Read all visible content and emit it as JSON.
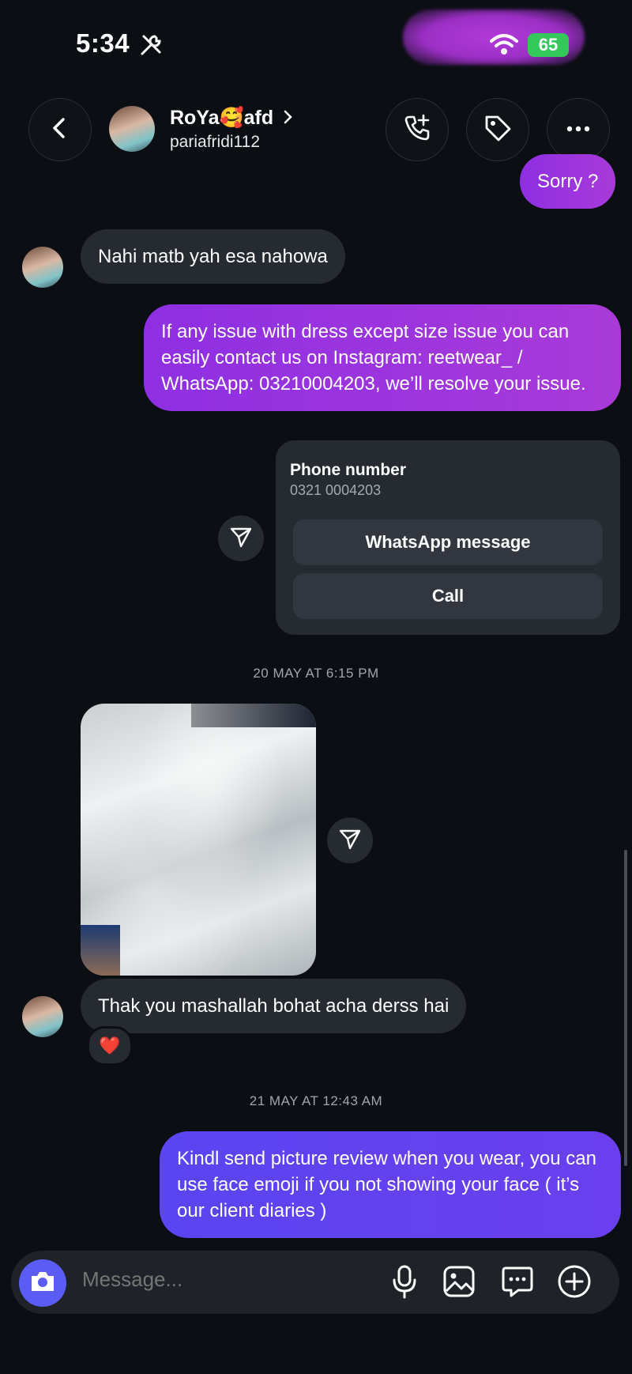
{
  "status_bar": {
    "time": "5:34",
    "battery": "65"
  },
  "header": {
    "contact_name": "RoYa🥰afd",
    "username": "pariafridi112",
    "icons": [
      "back-chevron-icon",
      "phone-plus-icon",
      "tag-icon",
      "more-icon"
    ]
  },
  "messages": {
    "sorry": "Sorry ?",
    "nahi": "Nahi matb yah esa nahowa",
    "dress_issue": "If any issue with dress except size issue you can easily contact us on Instagram: reetwear_ /  WhatsApp: 03210004203,  we’ll resolve your issue.",
    "thank_you": "Thak you mashallah bohat acha derss hai",
    "reaction": "❤️",
    "kindly": "Kindl send picture review when you wear, you can use face emoji if you not showing your face ( it’s our client diaries )"
  },
  "phone_card": {
    "title": "Phone number",
    "number": "0321 0004203",
    "whatsapp_label": "WhatsApp message",
    "call_label": "Call"
  },
  "timestamps": {
    "first": "20 MAY AT 6:15 PM",
    "second": "21 MAY AT 12:43 AM"
  },
  "composer": {
    "placeholder": "Message..."
  },
  "colors": {
    "background": "#0b0e13",
    "incoming_bubble": "#262a31",
    "outgoing_purple": "#a93ad8",
    "outgoing_blue": "#5a45f0",
    "camera_button": "#5b5cf5"
  }
}
